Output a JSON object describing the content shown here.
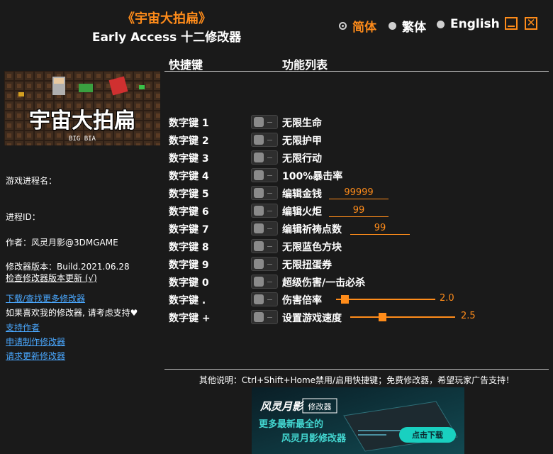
{
  "header": {
    "title": "《宇宙大拍扁》",
    "subtitle": "Early Access 十二修改器"
  },
  "languages": [
    {
      "label": "简体",
      "selected": true
    },
    {
      "label": "繁体",
      "selected": false
    },
    {
      "label": "English",
      "selected": false
    }
  ],
  "cover": {
    "title": "宇宙大拍扁",
    "subtitle": "BIG BIA"
  },
  "left": {
    "process_name_label": "游戏进程名：",
    "process_id_label": "进程ID：",
    "author": "作者：风灵月影@3DMGAME",
    "version": "修改器版本：Build.2021.06.28",
    "check_update": "检查修改器版本更新 (√)",
    "download_more": "下载/查找更多修改器",
    "support_text": "如果喜欢我的修改器, 请考虑支持♥",
    "support_author": "支持作者",
    "request_trainer": "申请制作修改器",
    "request_update": "请求更新修改器"
  },
  "columns": {
    "hotkey": "快捷键",
    "features": "功能列表"
  },
  "rows": [
    {
      "hotkey": "数字键 1",
      "label": "无限生命"
    },
    {
      "hotkey": "数字键 2",
      "label": "无限护甲"
    },
    {
      "hotkey": "数字键 3",
      "label": "无限行动"
    },
    {
      "hotkey": "数字键 4",
      "label": "100%暴击率"
    },
    {
      "hotkey": "数字键 5",
      "label": "编辑金钱",
      "value": "99999"
    },
    {
      "hotkey": "数字键 6",
      "label": "编辑火炬",
      "value": "99"
    },
    {
      "hotkey": "数字键 7",
      "label": "编辑祈祷点数",
      "value": "99"
    },
    {
      "hotkey": "数字键 8",
      "label": "无限蓝色方块"
    },
    {
      "hotkey": "数字键 9",
      "label": "无限扭蛋券"
    },
    {
      "hotkey": "数字键 0",
      "label": "超级伤害/一击必杀"
    },
    {
      "hotkey": "数字键 .",
      "label": "伤害倍率",
      "slider": "2.0",
      "slider_fraction": 0.05
    },
    {
      "hotkey": "数字键 +",
      "label": "设置游戏速度",
      "slider": "2.5",
      "slider_fraction": 0.27
    }
  ],
  "footer": {
    "note": "其他说明：Ctrl+Shift+Home禁用/启用快捷键；免费修改器，希望玩家广告支持！",
    "banner_logo": "风灵月影",
    "banner_tag": "修改器",
    "banner_line1": "更多最新最全的",
    "banner_line2": "风灵月影修改器",
    "banner_button": "点击下载"
  },
  "colors": {
    "accent": "#ff8c1a",
    "link": "#4aa8ff",
    "background": "#1a1a1a"
  }
}
